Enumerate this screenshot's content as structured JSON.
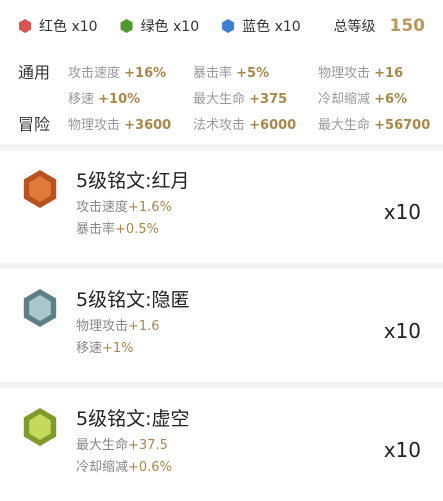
{
  "summary": {
    "red_label": "红色 x10",
    "green_label": "绿色 x10",
    "blue_label": "蓝色 x10",
    "red_color": "#d9534f",
    "green_color": "#4f9a2f",
    "blue_color": "#3e7fd1",
    "total_label": "总等级",
    "total_value": "150"
  },
  "general": {
    "label": "通用",
    "row1": [
      {
        "name": "攻击速度",
        "value": "+16%"
      },
      {
        "name": "暴击率",
        "value": "+5%"
      },
      {
        "name": "物理攻击",
        "value": "+16"
      }
    ],
    "row2": [
      {
        "name": "移速",
        "value": "+10%"
      },
      {
        "name": "最大生命",
        "value": "+375"
      },
      {
        "name": "冷却缩减",
        "value": "+6%"
      }
    ]
  },
  "adventure": {
    "label": "冒险",
    "row": [
      {
        "name": "物理攻击",
        "value": "+3600"
      },
      {
        "name": "法术攻击",
        "value": "+6000"
      },
      {
        "name": "最大生命",
        "value": "+56700"
      }
    ]
  },
  "runes": [
    {
      "title": "5级铭文:红月",
      "icon": "red-moon-rune-icon",
      "color_outer": "#b8521f",
      "color_inner": "#e07a3a",
      "stats": [
        {
          "name": "攻击速度",
          "value": "+1.6%"
        },
        {
          "name": "暴击率",
          "value": "+0.5%"
        }
      ],
      "qty": "x10"
    },
    {
      "title": "5级铭文:隐匿",
      "icon": "hidden-rune-icon",
      "color_outer": "#5e7f86",
      "color_inner": "#a9c7cc",
      "stats": [
        {
          "name": "物理攻击",
          "value": "+1.6"
        },
        {
          "name": "移速",
          "value": "+1%"
        }
      ],
      "qty": "x10"
    },
    {
      "title": "5级铭文:虚空",
      "icon": "void-rune-icon",
      "color_outer": "#7f9a2a",
      "color_inner": "#c5d95b",
      "stats": [
        {
          "name": "最大生命",
          "value": "+37.5"
        },
        {
          "name": "冷却缩减",
          "value": "+0.6%"
        }
      ],
      "qty": "x10"
    }
  ]
}
